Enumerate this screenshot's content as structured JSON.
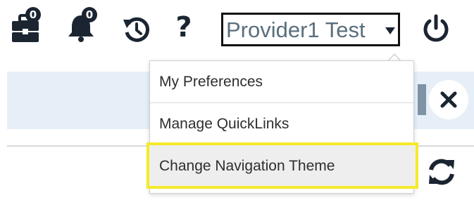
{
  "toolbar": {
    "briefcase": {
      "icon": "briefcase-icon",
      "count": "0"
    },
    "notifications": {
      "icon": "bell-icon",
      "count": "0"
    },
    "history": {
      "icon": "history-icon"
    },
    "help": {
      "icon": "help-icon",
      "glyph": "?"
    },
    "user": {
      "name": "Provider1 Test",
      "icon": "caret-down-icon"
    },
    "power": {
      "icon": "power-icon"
    }
  },
  "user_menu": {
    "items": [
      {
        "label": "My Preferences"
      },
      {
        "label": "Manage QuickLinks"
      },
      {
        "label": "Change Navigation Theme",
        "highlighted": true
      }
    ]
  },
  "page": {
    "close_icon": "close-icon",
    "refresh_icon": "refresh-icon"
  },
  "colors": {
    "icon_dark": "#1b2531",
    "user_text": "#5a6e7c",
    "highlight_border": "#f5ea2a",
    "highlight_bg": "#eeeeee",
    "strip_blue": "#e6eff8"
  }
}
